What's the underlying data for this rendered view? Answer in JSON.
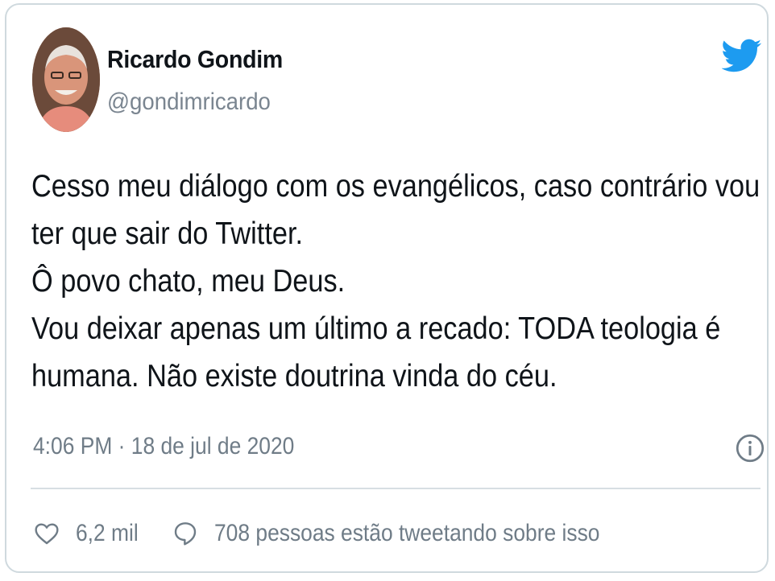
{
  "tweet": {
    "author_name": "Ricardo Gondim",
    "author_handle": "@gondimricardo",
    "text_lines": [
      "Cesso meu diálogo com os evangélicos, caso contrário vou",
      "ter que sair do Twitter.",
      "Ô povo chato, meu Deus.",
      "Vou deixar apenas um último a recado: TODA teologia é",
      "humana. Não existe doutrina vinda do céu."
    ],
    "timestamp": "4:06 PM · 18 de jul de 2020"
  },
  "actions": {
    "likes": "6,2 mil",
    "conversation": "708 pessoas estão tweetando sobre isso"
  },
  "icons": {
    "brand": "twitter-bird-icon",
    "info": "info-icon",
    "like": "heart-icon",
    "reply": "speech-bubble-icon"
  },
  "colors": {
    "twitter_blue": "#1d9bf0",
    "text": "#0f1419",
    "secondary_text": "#6f7c87",
    "border": "#cfd9de"
  }
}
